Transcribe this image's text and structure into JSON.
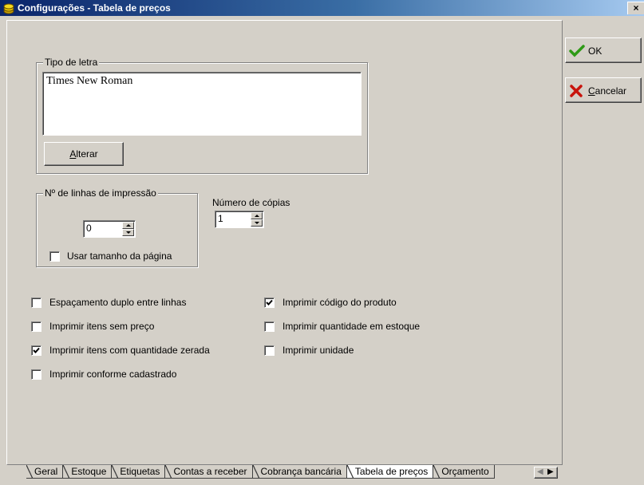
{
  "window": {
    "title": "Configurações - Tabela de preços",
    "close_glyph": "×",
    "icon": "coins-icon"
  },
  "actions": {
    "ok_label": "OK",
    "ok_icon": "checkmark-icon",
    "cancel_label": "Cancelar",
    "cancel_icon": "x-icon"
  },
  "font_group": {
    "legend": "Tipo de letra",
    "font_name": "Times New Roman",
    "change_label": "Alterar"
  },
  "lines_group": {
    "legend": "Nº de linhas de impressão",
    "lines_value": "0",
    "use_page_size_label": "Usar tamanho da página",
    "use_page_size_checked": false
  },
  "copies": {
    "label": "Número de cópias",
    "value": "1"
  },
  "options_left": [
    {
      "label": "Espaçamento duplo entre linhas",
      "checked": false
    },
    {
      "label": "Imprimir itens sem preço",
      "checked": false
    },
    {
      "label": "Imprimir itens com quantidade zerada",
      "checked": true
    },
    {
      "label": "Imprimir conforme cadastrado",
      "checked": false
    }
  ],
  "options_right": [
    {
      "label": "Imprimir código do produto",
      "checked": true
    },
    {
      "label": "Imprimir quantidade em estoque",
      "checked": false
    },
    {
      "label": "Imprimir unidade",
      "checked": false
    }
  ],
  "tabs": [
    {
      "label": "Geral",
      "selected": false
    },
    {
      "label": "Estoque",
      "selected": false
    },
    {
      "label": "Etiquetas",
      "selected": false
    },
    {
      "label": "Contas a receber",
      "selected": false
    },
    {
      "label": "Cobrança bancária",
      "selected": false
    },
    {
      "label": "Tabela de preços",
      "selected": true
    },
    {
      "label": "Orçamento",
      "selected": false
    }
  ],
  "colors": {
    "face": "#d4d0c8",
    "title_start": "#0a246a",
    "title_end": "#a6caf0",
    "ok_green": "#2e9a16",
    "cancel_red": "#c8140c"
  }
}
